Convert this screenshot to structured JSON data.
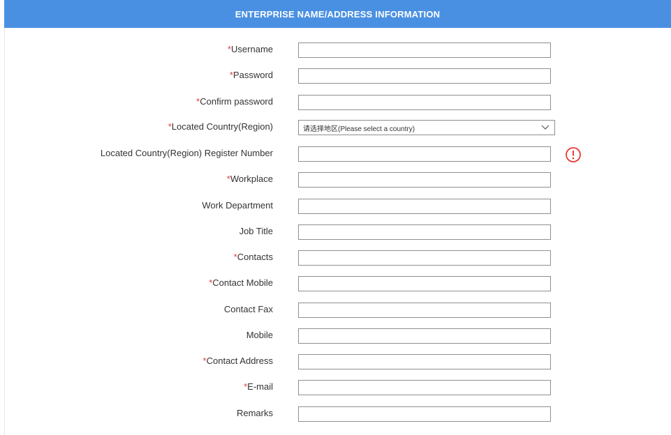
{
  "header": {
    "title": "ENTERPRISE NAME/ADDRESS INFORMATION"
  },
  "colors": {
    "header_background": "#4a90e2",
    "required_mark": "#e53935",
    "warning_icon": "#e53935"
  },
  "required_marker": "*",
  "form": {
    "username": {
      "label": "Username",
      "required": true,
      "value": ""
    },
    "password": {
      "label": "Password",
      "required": true,
      "value": ""
    },
    "confirm_password": {
      "label": "Confirm password",
      "required": true,
      "value": ""
    },
    "country": {
      "label": "Located Country(Region)",
      "required": true,
      "selected": "请选择地区(Please select a country)"
    },
    "register_number": {
      "label": "Located Country(Region) Register Number",
      "required": false,
      "value": "",
      "status_icon": "exclamation-circle-icon"
    },
    "workplace": {
      "label": "Workplace",
      "required": true,
      "value": ""
    },
    "work_department": {
      "label": "Work Department",
      "required": false,
      "value": ""
    },
    "job_title": {
      "label": "Job Title",
      "required": false,
      "value": ""
    },
    "contacts": {
      "label": "Contacts",
      "required": true,
      "value": ""
    },
    "contact_mobile": {
      "label": "Contact Mobile",
      "required": true,
      "value": ""
    },
    "contact_fax": {
      "label": "Contact Fax",
      "required": false,
      "value": ""
    },
    "mobile": {
      "label": "Mobile",
      "required": false,
      "value": ""
    },
    "contact_address": {
      "label": "Contact Address",
      "required": true,
      "value": ""
    },
    "email": {
      "label": "E-mail",
      "required": true,
      "value": ""
    },
    "remarks": {
      "label": "Remarks",
      "required": false,
      "value": ""
    }
  }
}
